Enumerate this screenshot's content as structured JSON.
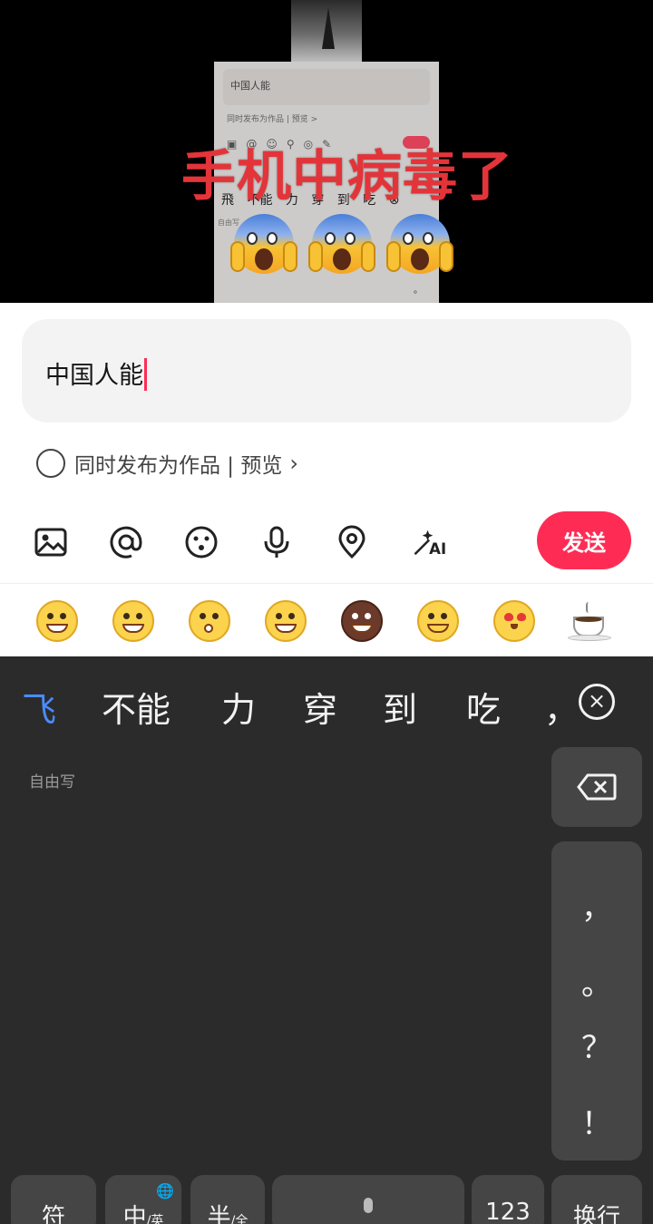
{
  "overlay": {
    "virus_text": "手机中病毒了",
    "preview_card": {
      "input_text": "中国人能",
      "publish_text": "同时发布为作品 | 预览 >",
      "candidates": "飛 不能 力 穿 到 吃 ⊗",
      "free_write": "自由写"
    },
    "scared_emoji": [
      "face-screaming-in-fear-icon",
      "face-screaming-in-fear-icon",
      "face-screaming-in-fear-icon"
    ]
  },
  "comment": {
    "input_value": "中国人能",
    "publish_as_work_label": "同时发布为作品 | 预览",
    "preview_chevron": "›",
    "send_label": "发送",
    "accent_color": "#fe2c55"
  },
  "toolbar": {
    "icons": [
      "image-icon",
      "at-mention-icon",
      "emoji-icon",
      "microphone-icon",
      "location-pin-icon",
      "ai-magic-wand-icon"
    ],
    "ai_label": "AI"
  },
  "emoji_strip": [
    "laughing-rolling-emoji",
    "grinning-sweat-emoji",
    "surprised-emoji",
    "grin-emoji",
    "brown-face-emoji",
    "smiling-emoji",
    "heart-eyes-kiss-emoji",
    "coffee-cup-emoji"
  ],
  "keyboard": {
    "candidates": [
      "飞",
      "不能",
      "力",
      "穿",
      "到",
      "吃",
      "，"
    ],
    "close_candidates": "×",
    "free_write_label": "自由写",
    "punctuation": [
      "，",
      "。",
      "？",
      "！"
    ],
    "bottom_keys": {
      "symbol": "符",
      "chinese": "中",
      "chinese_sub": "/英",
      "half": "半",
      "half_sub": "/全",
      "numbers": "123",
      "enter": "换行"
    },
    "candidate_highlight_color": "#4a8cff"
  }
}
